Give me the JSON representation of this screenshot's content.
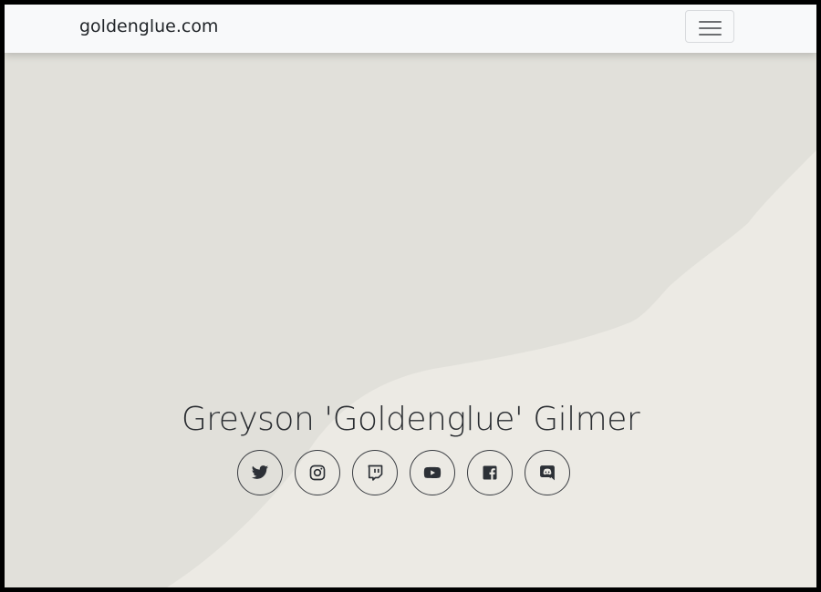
{
  "navbar": {
    "brand": "goldenglue.com",
    "toggler_icon": "hamburger-menu-icon"
  },
  "hero": {
    "title": "Greyson 'Goldenglue' Gilmer"
  },
  "social_links": [
    {
      "name": "twitter",
      "icon": "twitter-icon"
    },
    {
      "name": "instagram",
      "icon": "instagram-icon"
    },
    {
      "name": "twitch",
      "icon": "twitch-icon"
    },
    {
      "name": "youtube",
      "icon": "youtube-icon"
    },
    {
      "name": "facebook",
      "icon": "facebook-icon"
    },
    {
      "name": "discord",
      "icon": "discord-icon"
    }
  ],
  "colors": {
    "page_background": "#eceae4",
    "background_shape": "#e1e0da",
    "navbar_background": "#f8f9fa",
    "text": "#212529",
    "icon": "#2c3036"
  }
}
